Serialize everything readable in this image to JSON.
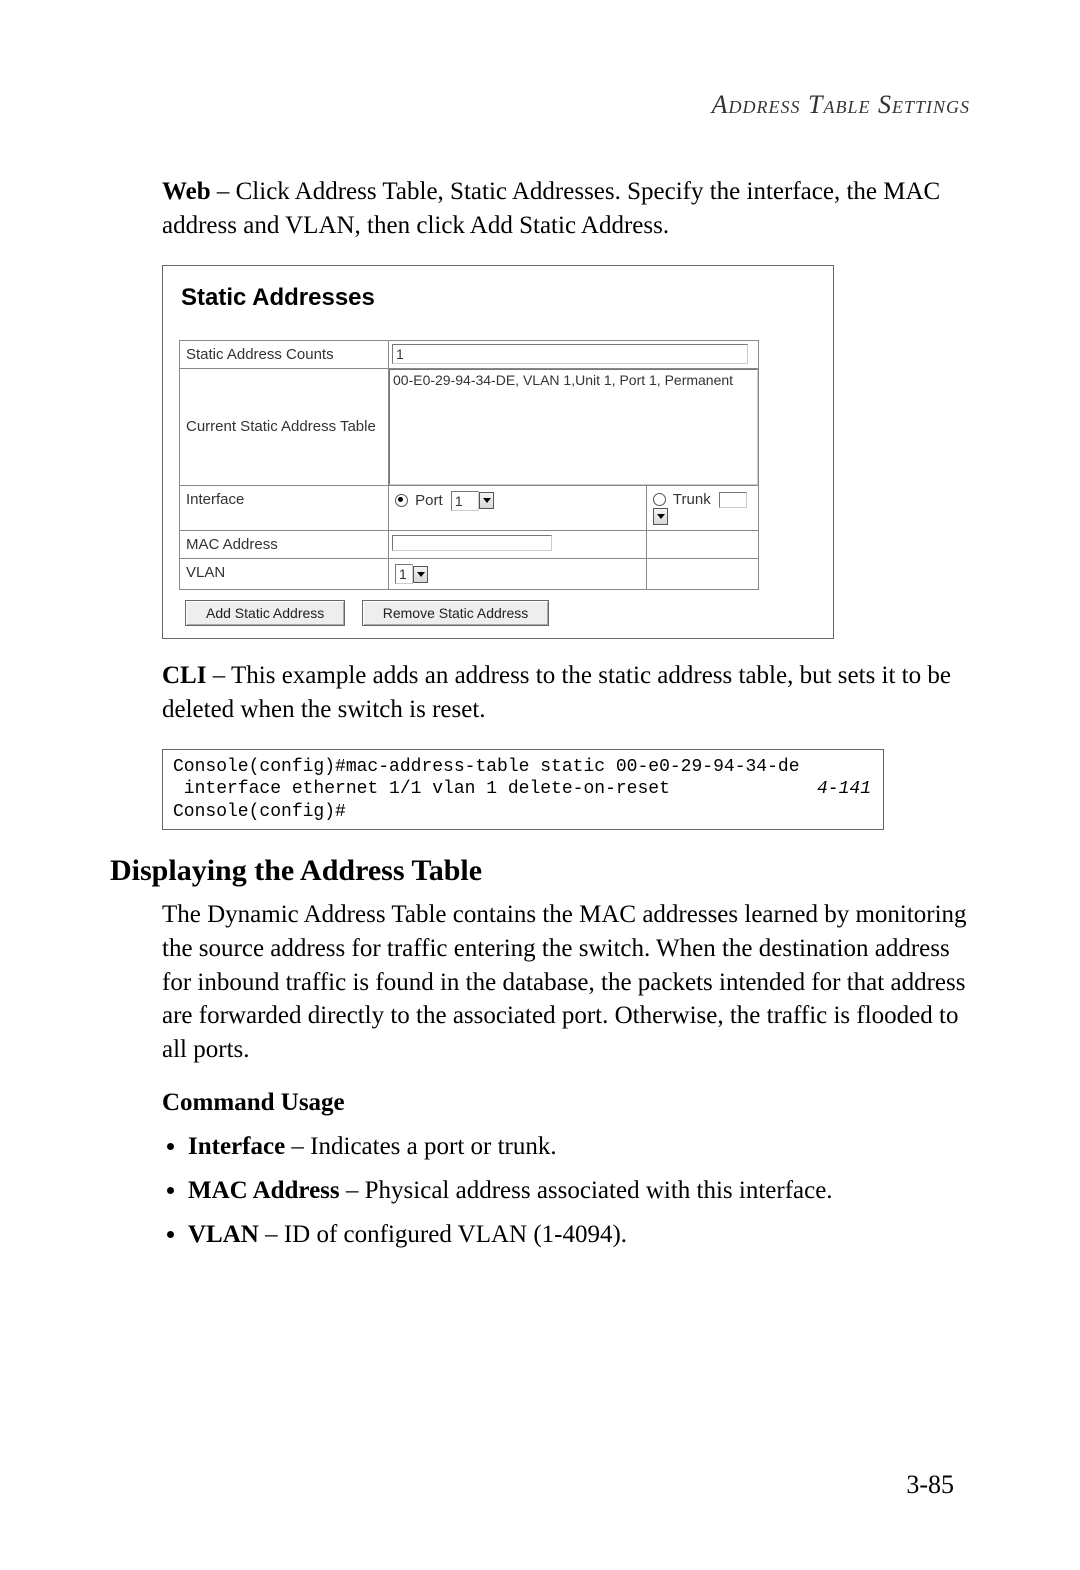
{
  "header": {
    "running": "Address Table Settings"
  },
  "web_intro": {
    "lead": "Web",
    "text": " – Click Address Table, Static Addresses. Specify the interface, the MAC address and VLAN, then click Add Static Address."
  },
  "screenshot": {
    "title": "Static Addresses",
    "rows": {
      "count_label": "Static Address Counts",
      "count_value": "1",
      "table_label": "Current Static Address Table",
      "table_entry": "00-E0-29-94-34-DE, VLAN 1,Unit 1, Port 1, Permanent",
      "iface_label": "Interface",
      "port_label": "Port",
      "port_value": "1",
      "trunk_label": "Trunk",
      "trunk_value": "",
      "mac_label": "MAC Address",
      "mac_value": "",
      "vlan_label": "VLAN",
      "vlan_value": "1"
    },
    "buttons": {
      "add": "Add Static Address",
      "remove": "Remove Static Address"
    }
  },
  "cli_intro": {
    "lead": "CLI",
    "text": " – This example adds an address to the static address table, but sets it to be deleted when the switch is reset."
  },
  "cli_code": "Console(config)#mac-address-table static 00-e0-29-94-34-de\n interface ethernet 1/1 vlan 1 delete-on-reset\nConsole(config)#",
  "cli_ref": "4-141",
  "section_title": "Displaying the Address Table",
  "section_para": "The Dynamic Address Table contains the MAC addresses learned by monitoring the source address for traffic entering the switch. When the destination address for inbound traffic is found in the database, the packets intended for that address are forwarded directly to the associated port. Otherwise, the traffic is flooded to all ports.",
  "cmd_usage_title": "Command Usage",
  "bullets": [
    {
      "term": "Interface",
      "desc": " – Indicates a port or trunk."
    },
    {
      "term": "MAC Address",
      "desc": " – Physical address associated with this interface."
    },
    {
      "term": "VLAN",
      "desc": " – ID of configured VLAN (1-4094)."
    }
  ],
  "page_number": "3-85"
}
